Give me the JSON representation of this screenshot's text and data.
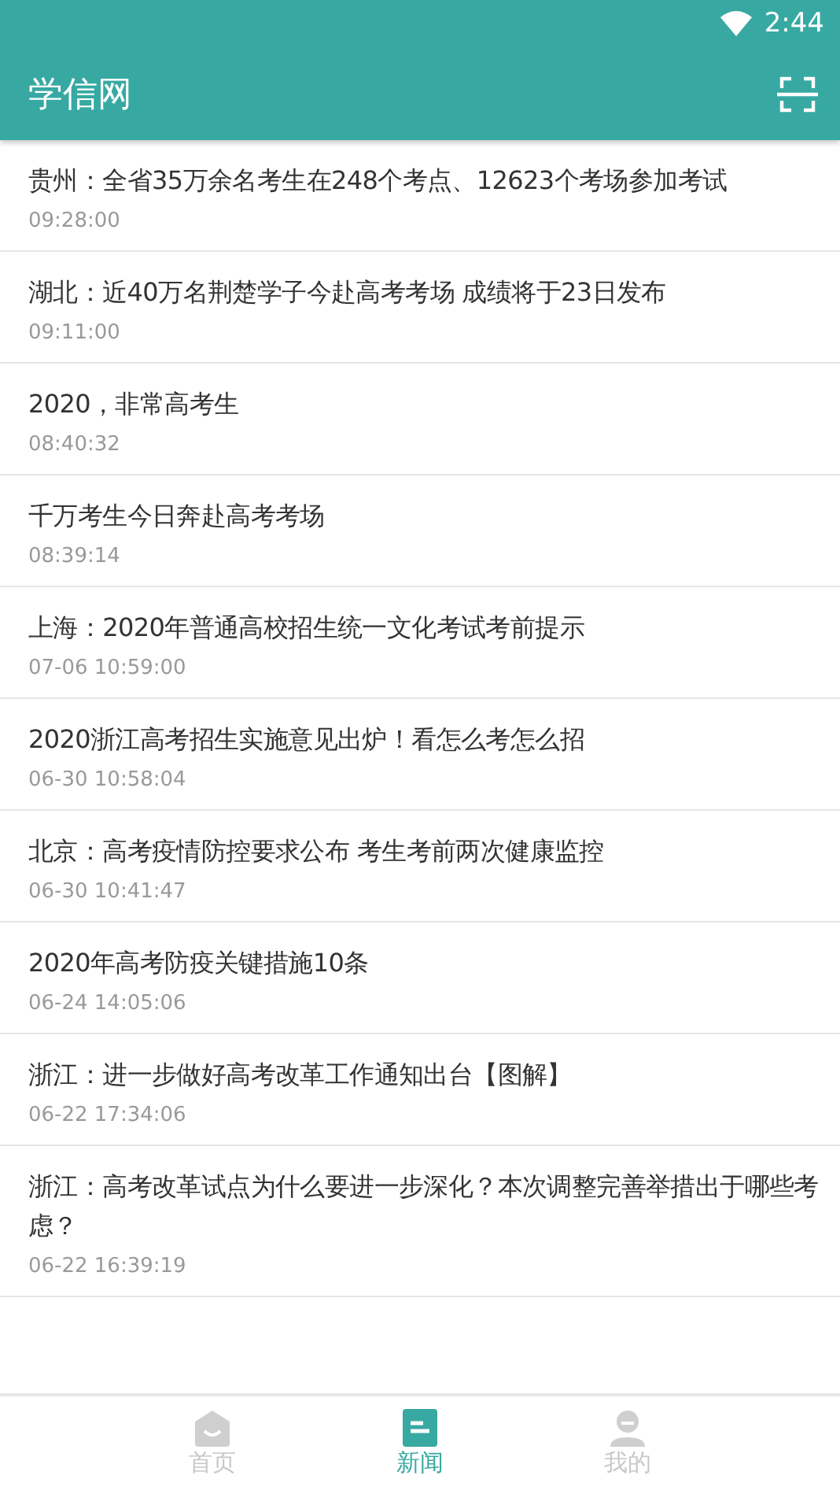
{
  "status_bar": {
    "time": "2:44"
  },
  "app_bar": {
    "title": "学信网"
  },
  "news": [
    {
      "title": "贵州：全省35万余名考生在248个考点、12623个考场参加考试",
      "time": "09:28:00"
    },
    {
      "title": "湖北：近40万名荆楚学子今赴高考考场 成绩将于23日发布",
      "time": "09:11:00"
    },
    {
      "title": "2020，非常高考生",
      "time": "08:40:32"
    },
    {
      "title": "千万考生今日奔赴高考考场",
      "time": "08:39:14"
    },
    {
      "title": "上海：2020年普通高校招生统一文化考试考前提示",
      "time": "07-06 10:59:00"
    },
    {
      "title": "2020浙江高考招生实施意见出炉！看怎么考怎么招",
      "time": "06-30 10:58:04"
    },
    {
      "title": "北京：高考疫情防控要求公布  考生考前两次健康监控",
      "time": "06-30 10:41:47"
    },
    {
      "title": "2020年高考防疫关键措施10条",
      "time": "06-24 14:05:06"
    },
    {
      "title": "浙江：进一步做好高考改革工作通知出台【图解】",
      "time": "06-22 17:34:06"
    },
    {
      "title": "浙江：高考改革试点为什么要进一步深化？本次调整完善举措出于哪些考虑？",
      "time": "06-22 16:39:19"
    }
  ],
  "bottom_nav": [
    {
      "label": "首页",
      "selected": false
    },
    {
      "label": "新闻",
      "selected": true
    },
    {
      "label": "我的",
      "selected": false
    }
  ]
}
